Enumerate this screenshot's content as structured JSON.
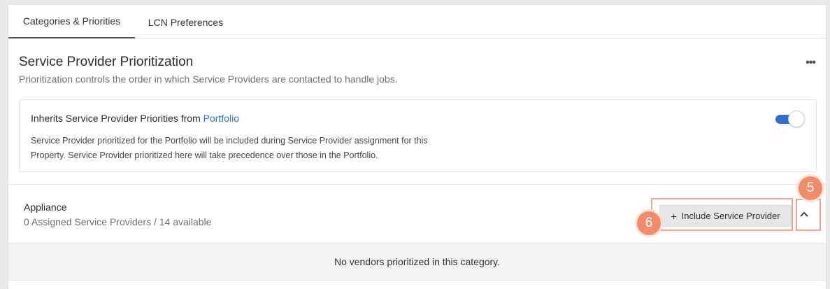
{
  "tabs": [
    {
      "label": "Categories & Priorities",
      "active": true
    },
    {
      "label": "LCN Preferences",
      "active": false
    }
  ],
  "header": {
    "title": "Service Provider Prioritization",
    "subtitle": "Prioritization controls the order in which Service Providers are contacted to handle jobs.",
    "more_icon": "more-horizontal-icon",
    "more_glyph": "•••"
  },
  "inherit": {
    "title_prefix": "Inherits Service Provider Priorities from ",
    "link": "Portfolio",
    "description": "Service Provider prioritized for the Portfolio will be included during Service Provider assignment for this Property. Service Provider prioritized here will take precedence over those in the Portfolio.",
    "toggle_on": true,
    "accent_color": "#2f6fd0"
  },
  "category": {
    "name": "Appliance",
    "summary": "0 Assigned Service Providers / 14 available",
    "include_icon": "+",
    "include_label": "Include Service Provider",
    "collapse_icon": "chevron-up-icon",
    "empty_message": "No vendors prioritized in this category."
  },
  "annotations": {
    "badge_5": "5",
    "badge_6": "6",
    "highlight_color": "#f08c6b"
  }
}
